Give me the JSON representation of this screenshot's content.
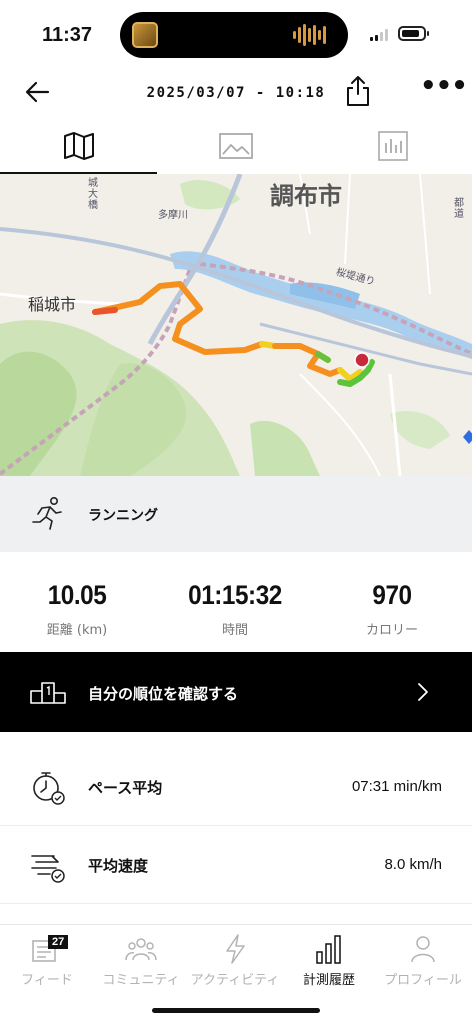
{
  "status_bar": {
    "time": "11:37"
  },
  "header": {
    "title": "2025/03/07 - 10:18"
  },
  "tabs": [
    {
      "name": "map-icon",
      "active": true
    },
    {
      "name": "image-icon",
      "active": false
    },
    {
      "name": "chart-icon",
      "active": false
    }
  ],
  "map": {
    "city_chofu": "調布市",
    "city_inagi": "稲城市",
    "label_tamagawa": "多摩川",
    "label_sakurazutsumi": "桜堤通り",
    "label_jodaibashi": "城大橋",
    "label_toritsu": "都道"
  },
  "activity": {
    "type": "ランニング"
  },
  "stats": [
    {
      "value": "10.05",
      "label": "距離 (km)"
    },
    {
      "value": "01:15:32",
      "label": "時間"
    },
    {
      "value": "970",
      "label": "カロリー"
    }
  ],
  "ranking": {
    "label": "自分の順位を確認する"
  },
  "metrics": [
    {
      "name": "ペース平均",
      "value": "07:31 min/km",
      "icon": "pace-stopwatch-icon"
    },
    {
      "name": "平均速度",
      "value": "8.0 km/h",
      "icon": "speed-icon"
    }
  ],
  "nav": {
    "items": [
      {
        "label": "フィード",
        "icon": "feed-icon",
        "badge": "27"
      },
      {
        "label": "コミュニティ",
        "icon": "community-icon"
      },
      {
        "label": "アクティビティ",
        "icon": "activity-bolt-icon"
      },
      {
        "label": "計測履歴",
        "icon": "history-bars-icon",
        "active": true
      },
      {
        "label": "プロフィール",
        "icon": "profile-icon"
      }
    ]
  },
  "colors": {
    "accent": "#000000",
    "route_orange": "#f5901e",
    "route_yellow": "#f2d022",
    "route_green": "#5cc43a"
  }
}
